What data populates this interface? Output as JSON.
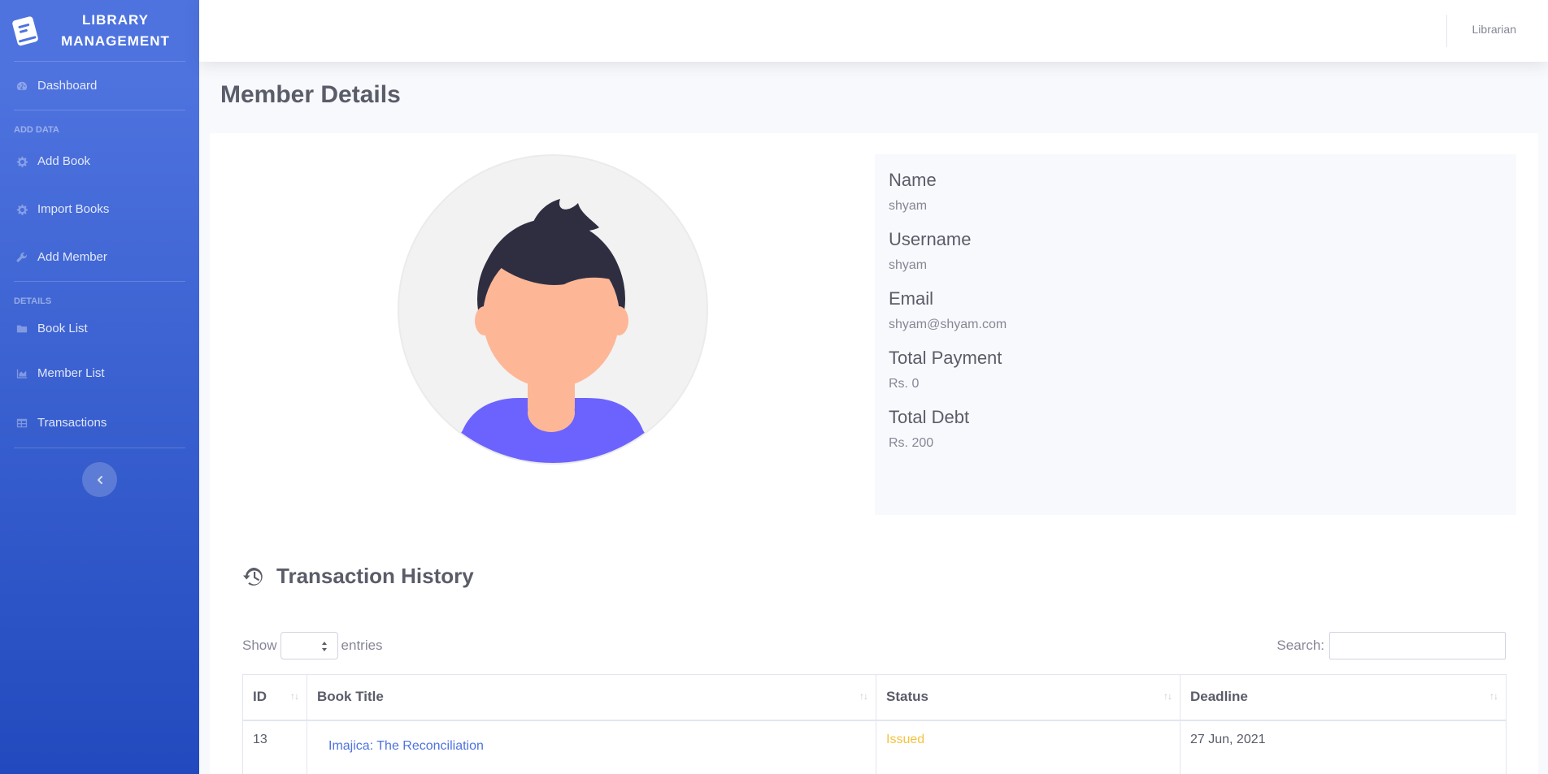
{
  "brand": {
    "line1": "LIBRARY",
    "line2": "MANAGEMENT"
  },
  "sidebar": {
    "dashboard": "Dashboard",
    "heading_add": "ADD DATA",
    "add_book": "Add Book",
    "import_books": "Import Books",
    "add_member": "Add Member",
    "heading_details": "DETAILS",
    "book_list": "Book List",
    "member_list": "Member List",
    "transactions": "Transactions"
  },
  "topbar": {
    "user": "Librarian"
  },
  "page": {
    "title": "Member Details"
  },
  "member": {
    "name_label": "Name",
    "name": "shyam",
    "username_label": "Username",
    "username": "shyam",
    "email_label": "Email",
    "email": "shyam@shyam.com",
    "payment_label": "Total Payment",
    "payment": "Rs. 0",
    "debt_label": "Total Debt",
    "debt": "Rs. 200"
  },
  "transactions": {
    "title": "Transaction History",
    "show": "Show",
    "entries": "entries",
    "search_label": "Search:",
    "columns": [
      "ID",
      "Book Title",
      "Status",
      "Deadline"
    ],
    "rows": [
      {
        "id": "13",
        "title": "Imajica: The Reconciliation",
        "status": "Issued",
        "deadline": "27 Jun, 2021"
      }
    ]
  },
  "colors": {
    "sidebar_top": "#4e73df",
    "sidebar_bottom": "#224abe",
    "link": "#4e73df",
    "issued": "#f6c23e",
    "avatar_shirt": "#6c63ff",
    "avatar_skin": "#fdb797",
    "avatar_hair": "#2f2e41"
  },
  "icons": {
    "brand": "book-icon",
    "dashboard": "tachometer-icon",
    "add_book": "cog-icon",
    "import_books": "cog-icon",
    "add_member": "wrench-icon",
    "book_list": "folder-icon",
    "member_list": "chart-area-icon",
    "transactions": "table-icon",
    "history": "history-icon",
    "toggle": "chevron-left-icon"
  }
}
